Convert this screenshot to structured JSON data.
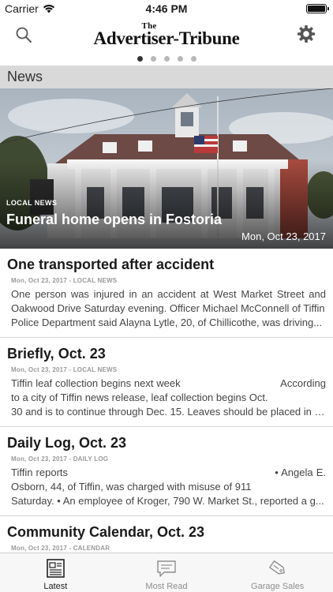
{
  "status_bar": {
    "carrier": "Carrier",
    "time": "4:46 PM"
  },
  "nav": {
    "masthead_small": "The",
    "masthead_name": "Advertiser-Tribune"
  },
  "pager": {
    "count": 5,
    "active_index": 0
  },
  "section": {
    "title": "News"
  },
  "hero": {
    "badge": "LOCAL NEWS",
    "title": "Funeral home opens in Fostoria",
    "date": "Mon, Oct 23, 2017"
  },
  "articles": [
    {
      "title": "One transported after accident",
      "meta": "Mon, Oct 23, 2017 - LOCAL NEWS",
      "snippet_line1": "One person was injured in an accident at West Market Street and Oakwood Drive Saturday evening. Officer Michael McConnell of Tiffin",
      "snippet_line2": "Police Department said Alayna Lytle, 20, of Chillicothe, was driving..."
    },
    {
      "title": "Briefly, Oct. 23",
      "meta": "Mon, Oct 23, 2017 - LOCAL NEWS",
      "snippet_line1": "Tiffin leaf collection begins next week                                  According to a city of Tiffin news release, leaf collection begins Oct.",
      "snippet_line2": "30 and is to continue through Dec. 15. Leaves should be placed in c..."
    },
    {
      "title": "Daily Log, Oct. 23",
      "meta": "Mon, Oct 23, 2017 - DAILY LOG",
      "snippet_line1": "Tiffin reports                                                                • Angela E. Osborn, 44, of Tiffin, was charged with misuse of 911",
      "snippet_line2": "Saturday. • An employee of Kroger, 790 W. Market St., reported a g..."
    },
    {
      "title": "Community Calendar, Oct. 23",
      "meta": "Mon, Oct 23, 2017 - CALENDAR"
    }
  ],
  "tabs": [
    {
      "label": "Latest",
      "icon": "newspaper-icon",
      "active": true
    },
    {
      "label": "Most Read",
      "icon": "chat-bubble-icon",
      "active": false
    },
    {
      "label": "Garage Sales",
      "icon": "sale-tag-icon",
      "active": false
    }
  ],
  "colors": {
    "section_header_bg": "#d9d9d9",
    "tab_active": "#222222",
    "tab_inactive": "#8e8e8e"
  }
}
